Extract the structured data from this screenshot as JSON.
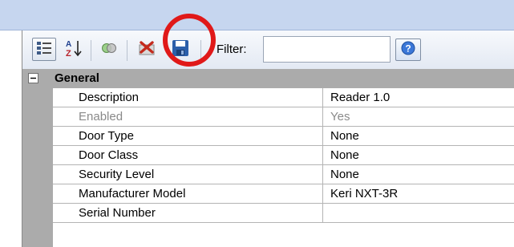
{
  "toolbar": {
    "filter_label": "Filter:",
    "filter_value": "",
    "icons": [
      "categorized-icon",
      "sort-alphabetical-icon",
      "toggle-icon",
      "delete-icon",
      "save-icon",
      "help-icon"
    ],
    "highlight_color": "#e01919"
  },
  "category": {
    "label": "General",
    "toggle": "−"
  },
  "properties": [
    {
      "name": "Description",
      "value": "Reader 1.0",
      "enabled": true
    },
    {
      "name": "Enabled",
      "value": "Yes",
      "enabled": false
    },
    {
      "name": "Door Type",
      "value": "None",
      "enabled": true
    },
    {
      "name": "Door Class",
      "value": "None",
      "enabled": true
    },
    {
      "name": "Security Level",
      "value": "None",
      "enabled": true
    },
    {
      "name": "Manufacturer Model",
      "value": "Keri NXT-3R",
      "enabled": true
    },
    {
      "name": "Serial Number",
      "value": "",
      "enabled": true
    }
  ]
}
